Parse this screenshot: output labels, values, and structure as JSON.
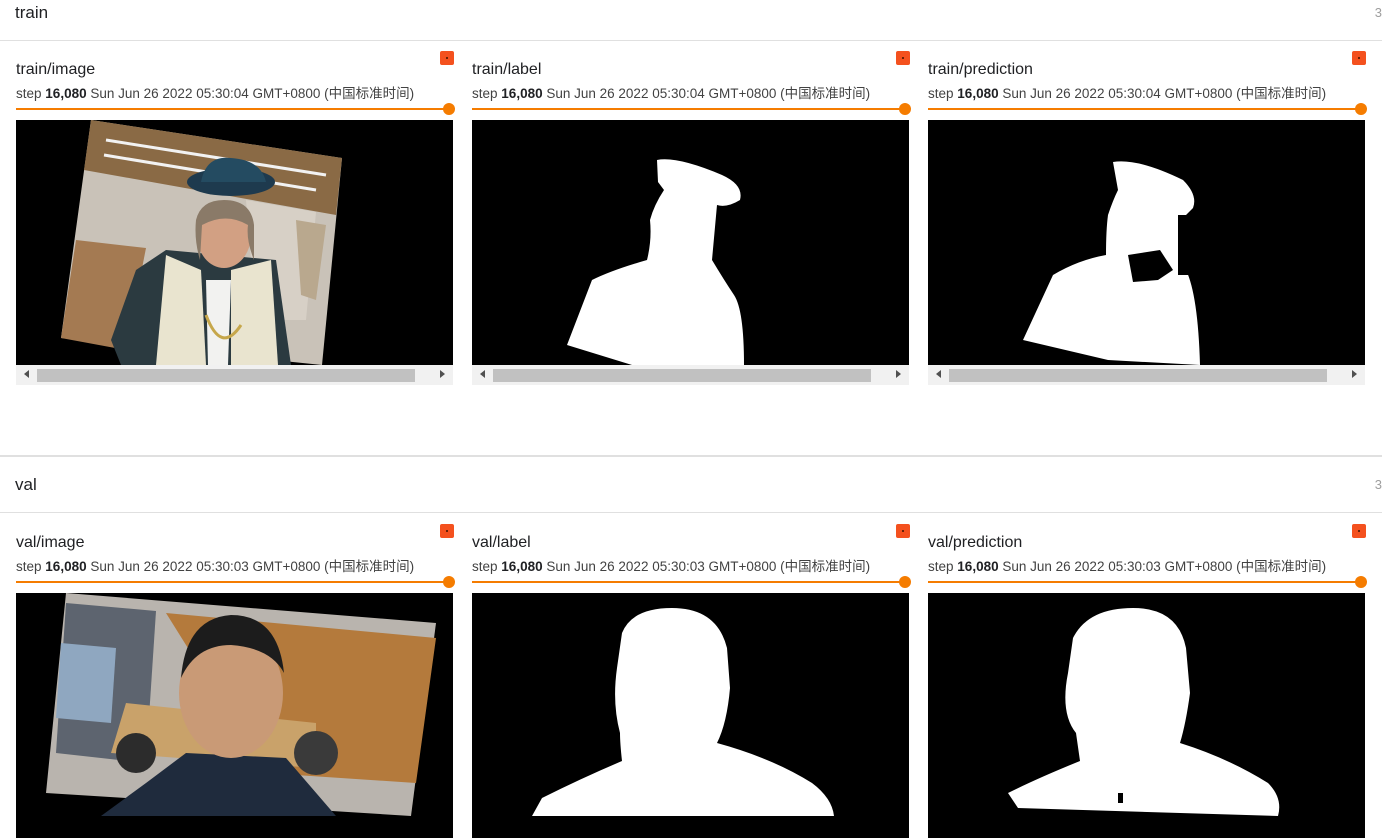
{
  "sections": [
    {
      "title": "train",
      "count": "3",
      "cards": [
        {
          "title": "train/image",
          "step_prefix": "step",
          "step": "16,080",
          "timestamp": "Sun Jun 26 2022 05:30:04 GMT+0800 (中国标准时间)"
        },
        {
          "title": "train/label",
          "step_prefix": "step",
          "step": "16,080",
          "timestamp": "Sun Jun 26 2022 05:30:04 GMT+0800 (中国标准时间)"
        },
        {
          "title": "train/prediction",
          "step_prefix": "step",
          "step": "16,080",
          "timestamp": "Sun Jun 26 2022 05:30:04 GMT+0800 (中国标准时间)"
        }
      ]
    },
    {
      "title": "val",
      "count": "3",
      "cards": [
        {
          "title": "val/image",
          "step_prefix": "step",
          "step": "16,080",
          "timestamp": "Sun Jun 26 2022 05:30:03 GMT+0800 (中国标准时间)"
        },
        {
          "title": "val/label",
          "step_prefix": "step",
          "step": "16,080",
          "timestamp": "Sun Jun 26 2022 05:30:03 GMT+0800 (中国标准时间)"
        },
        {
          "title": "val/prediction",
          "step_prefix": "step",
          "step": "16,080",
          "timestamp": "Sun Jun 26 2022 05:30:03 GMT+0800 (中国标准时间)"
        }
      ]
    }
  ],
  "colors": {
    "accent": "#f57c00",
    "pin": "#f4511e",
    "image_bg": "#000000"
  },
  "step_slider_fraction": 1.0
}
